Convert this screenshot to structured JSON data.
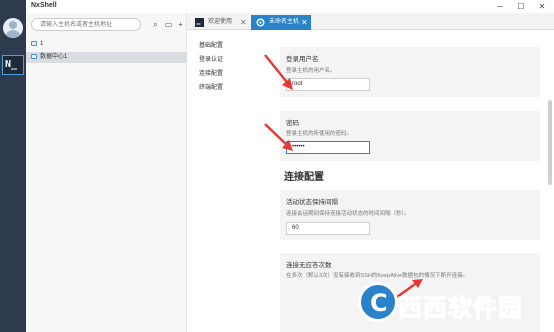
{
  "app": {
    "title": "NxShell"
  },
  "window_controls": {
    "minimize": "─",
    "maximize": "☐",
    "close": "✕"
  },
  "search": {
    "placeholder": "请输入主机名或者主机地址"
  },
  "toolbar": {
    "search_icon": "⌕",
    "folder_icon": "▭",
    "add_icon": "+"
  },
  "tree": [
    {
      "label": "1"
    },
    {
      "label": "数据中心1"
    }
  ],
  "tabs": [
    {
      "label": "欢迎使用",
      "close": "✕"
    },
    {
      "label": "未命名主机",
      "close": "✕"
    }
  ],
  "nav": [
    "基础配置",
    "登录认证",
    "连接配置",
    "终端配置"
  ],
  "login": {
    "user_label": "登录用户名",
    "user_desc": "登录主机的用户名。",
    "user_value": "root",
    "pass_label": "密码",
    "pass_desc": "登录主机的所使用的密码。",
    "pass_value": "••••••"
  },
  "connection": {
    "heading": "连接配置",
    "keepalive_label": "活动状态保持间隔",
    "keepalive_desc": "连接会话期间保持连接活动状态的时间间隔（秒）。",
    "keepalive_value": "60",
    "noresp_label": "连接无应答次数",
    "noresp_desc": "在多次（默认3次）没有接收到SSH的KeepAlive数据包的情况下断开连接。"
  },
  "watermark": {
    "glyph": "C",
    "text_a": "西西",
    "text_b": "软件园"
  },
  "colors": {
    "accent": "#2a82c9",
    "strip": "#2e3b4e",
    "annotation": "#e53935"
  }
}
